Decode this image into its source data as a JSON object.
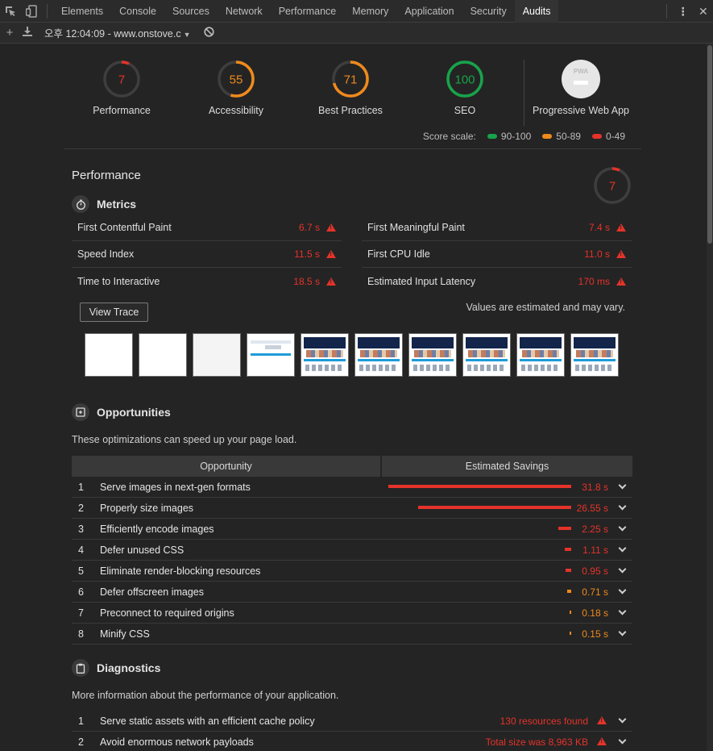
{
  "tabbar": {
    "tabs": [
      {
        "label": "Elements"
      },
      {
        "label": "Console"
      },
      {
        "label": "Sources"
      },
      {
        "label": "Network"
      },
      {
        "label": "Performance"
      },
      {
        "label": "Memory"
      },
      {
        "label": "Application"
      },
      {
        "label": "Security"
      },
      {
        "label": "Audits",
        "active": true
      }
    ]
  },
  "toolbar": {
    "report_select": "오후 12:04:09 - www.onstove.c"
  },
  "gauges": [
    {
      "label": "Performance",
      "score": "7",
      "color": "#e5332a"
    },
    {
      "label": "Accessibility",
      "score": "55",
      "color": "#ef8a1c"
    },
    {
      "label": "Best Practices",
      "score": "71",
      "color": "#ef8a1c"
    },
    {
      "label": "SEO",
      "score": "100",
      "color": "#17a34a"
    }
  ],
  "pwa": {
    "label": "Progressive Web App",
    "badge": "PWA"
  },
  "score_scale": {
    "label": "Score scale:",
    "ranges": [
      {
        "label": "90-100",
        "color": "#17a34a"
      },
      {
        "label": "50-89",
        "color": "#ef8a1c"
      },
      {
        "label": "0-49",
        "color": "#e5332a"
      }
    ]
  },
  "performance": {
    "title": "Performance",
    "score": "7",
    "metrics_title": "Metrics",
    "metrics_left": [
      {
        "name": "First Contentful Paint",
        "value": "6.7 s"
      },
      {
        "name": "Speed Index",
        "value": "11.5 s"
      },
      {
        "name": "Time to Interactive",
        "value": "18.5 s"
      }
    ],
    "metrics_right": [
      {
        "name": "First Meaningful Paint",
        "value": "7.4 s"
      },
      {
        "name": "First CPU Idle",
        "value": "11.0 s"
      },
      {
        "name": "Estimated Input Latency",
        "value": "170 ms"
      }
    ],
    "view_trace": "View Trace",
    "values_note": "Values are estimated and may vary."
  },
  "opportunities": {
    "title": "Opportunities",
    "description": "These optimizations can speed up your page load.",
    "col_opportunity": "Opportunity",
    "col_savings": "Estimated Savings",
    "rows": [
      {
        "num": "1",
        "title": "Serve images in next-gen formats",
        "savings": "31.8 s",
        "fraction": 1.0,
        "color": "#e5332a"
      },
      {
        "num": "2",
        "title": "Properly size images",
        "savings": "26.55 s",
        "fraction": 0.835,
        "color": "#e5332a"
      },
      {
        "num": "3",
        "title": "Efficiently encode images",
        "savings": "2.25 s",
        "fraction": 0.071,
        "color": "#e5332a"
      },
      {
        "num": "4",
        "title": "Defer unused CSS",
        "savings": "1.11 s",
        "fraction": 0.035,
        "color": "#e5332a"
      },
      {
        "num": "5",
        "title": "Eliminate render-blocking resources",
        "savings": "0.95 s",
        "fraction": 0.03,
        "color": "#e5332a"
      },
      {
        "num": "6",
        "title": "Defer offscreen images",
        "savings": "0.71 s",
        "fraction": 0.022,
        "color": "#ef8a1c"
      },
      {
        "num": "7",
        "title": "Preconnect to required origins",
        "savings": "0.18 s",
        "fraction": 0.006,
        "color": "#ef8a1c"
      },
      {
        "num": "8",
        "title": "Minify CSS",
        "savings": "0.15 s",
        "fraction": 0.005,
        "color": "#ef8a1c"
      }
    ]
  },
  "diagnostics": {
    "title": "Diagnostics",
    "description": "More information about the performance of your application.",
    "rows": [
      {
        "num": "1",
        "title": "Serve static assets with an efficient cache policy",
        "value": "130 resources found"
      },
      {
        "num": "2",
        "title": "Avoid enormous network payloads",
        "value": "Total size was 8,963 KB"
      }
    ]
  }
}
